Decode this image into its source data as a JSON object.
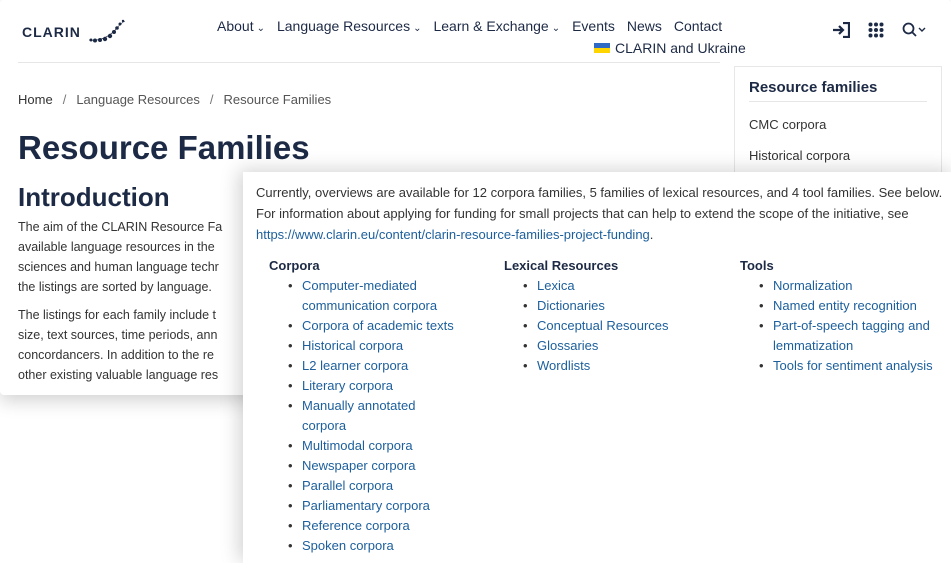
{
  "header": {
    "logo_text": "CLARIN",
    "nav": [
      {
        "label": "About",
        "chevron": true
      },
      {
        "label": "Language Resources",
        "chevron": true
      },
      {
        "label": "Learn & Exchange",
        "chevron": true
      },
      {
        "label": "Events",
        "chevron": false
      },
      {
        "label": "News",
        "chevron": false
      },
      {
        "label": "Contact",
        "chevron": false
      }
    ],
    "ukraine_label": "CLARIN and Ukraine",
    "icons": [
      "login-icon",
      "apps-grid-icon",
      "search-icon"
    ]
  },
  "breadcrumb": [
    "Home",
    "Language Resources",
    "Resource Families"
  ],
  "page": {
    "title": "Resource Families",
    "section": "Introduction",
    "para1": [
      "The aim of the CLARIN Resource Fa",
      "available language resources in the",
      "sciences and human language techr",
      "the listings  are sorted by language."
    ],
    "para2": [
      "The listings for each family include t",
      "size, text sources, time periods, ann",
      "concordancers. In addition to the re",
      "other existing valuable language res"
    ]
  },
  "sidebar": {
    "title": "Resource families",
    "items": [
      "CMC corpora",
      "Historical corpora"
    ]
  },
  "overlay": {
    "intro_1": "Currently, overviews are available for 12 corpora families, 5 families of lexical resources, and 4 tool families. See below. For information about applying for funding for small projects that can help to extend the scope of the initiative, see ",
    "intro_link": "https://www.clarin.eu/content/clarin-resource-families-project-funding",
    "intro_end": ".",
    "columns": [
      {
        "heading": "Corpora",
        "items": [
          "Computer-mediated communication corpora",
          "Corpora of academic texts",
          "Historical corpora",
          "L2 learner corpora",
          "Literary corpora",
          "Manually annotated corpora",
          "Multimodal corpora",
          "Newspaper corpora",
          "Parallel corpora",
          "Parliamentary corpora",
          "Reference corpora",
          "Spoken corpora"
        ]
      },
      {
        "heading": "Lexical Resources",
        "items": [
          "Lexica",
          "Dictionaries",
          "Conceptual Resources",
          "Glossaries",
          "Wordlists"
        ]
      },
      {
        "heading": "Tools",
        "items": [
          "Normalization",
          "Named entity recognition",
          "Part-of-speech tagging and lemmatization",
          "Tools for sentiment analysis"
        ]
      }
    ]
  }
}
